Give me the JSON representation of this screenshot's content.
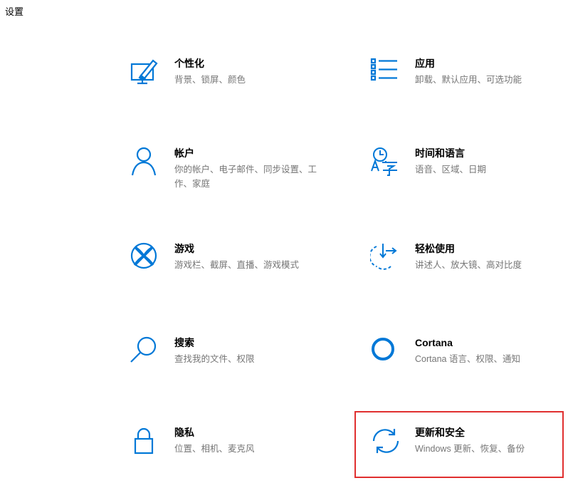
{
  "app": {
    "title": "设置"
  },
  "colors": {
    "accent": "#0078d7",
    "highlight": "#e02f2f",
    "desc": "#767676"
  },
  "tiles": [
    {
      "title": "个性化",
      "desc": "背景、锁屏、颜色",
      "icon": "personalization-icon"
    },
    {
      "title": "应用",
      "desc": "卸载、默认应用、可选功能",
      "icon": "apps-list-icon"
    },
    {
      "title": "帐户",
      "desc": "你的帐户、电子邮件、同步设置、工作、家庭",
      "icon": "person-icon"
    },
    {
      "title": "时间和语言",
      "desc": "语音、区域、日期",
      "icon": "time-language-icon"
    },
    {
      "title": "游戏",
      "desc": "游戏栏、截屏、直播、游戏模式",
      "icon": "xbox-icon"
    },
    {
      "title": "轻松使用",
      "desc": "讲述人、放大镜、高对比度",
      "icon": "ease-of-access-icon"
    },
    {
      "title": "搜索",
      "desc": "查找我的文件、权限",
      "icon": "search-icon"
    },
    {
      "title": "Cortana",
      "desc": "Cortana 语言、权限、通知",
      "icon": "cortana-circle-icon"
    },
    {
      "title": "隐私",
      "desc": "位置、相机、麦克风",
      "icon": "lock-icon"
    },
    {
      "title": "更新和安全",
      "desc": "Windows 更新、恢复、备份",
      "icon": "update-sync-icon"
    }
  ]
}
